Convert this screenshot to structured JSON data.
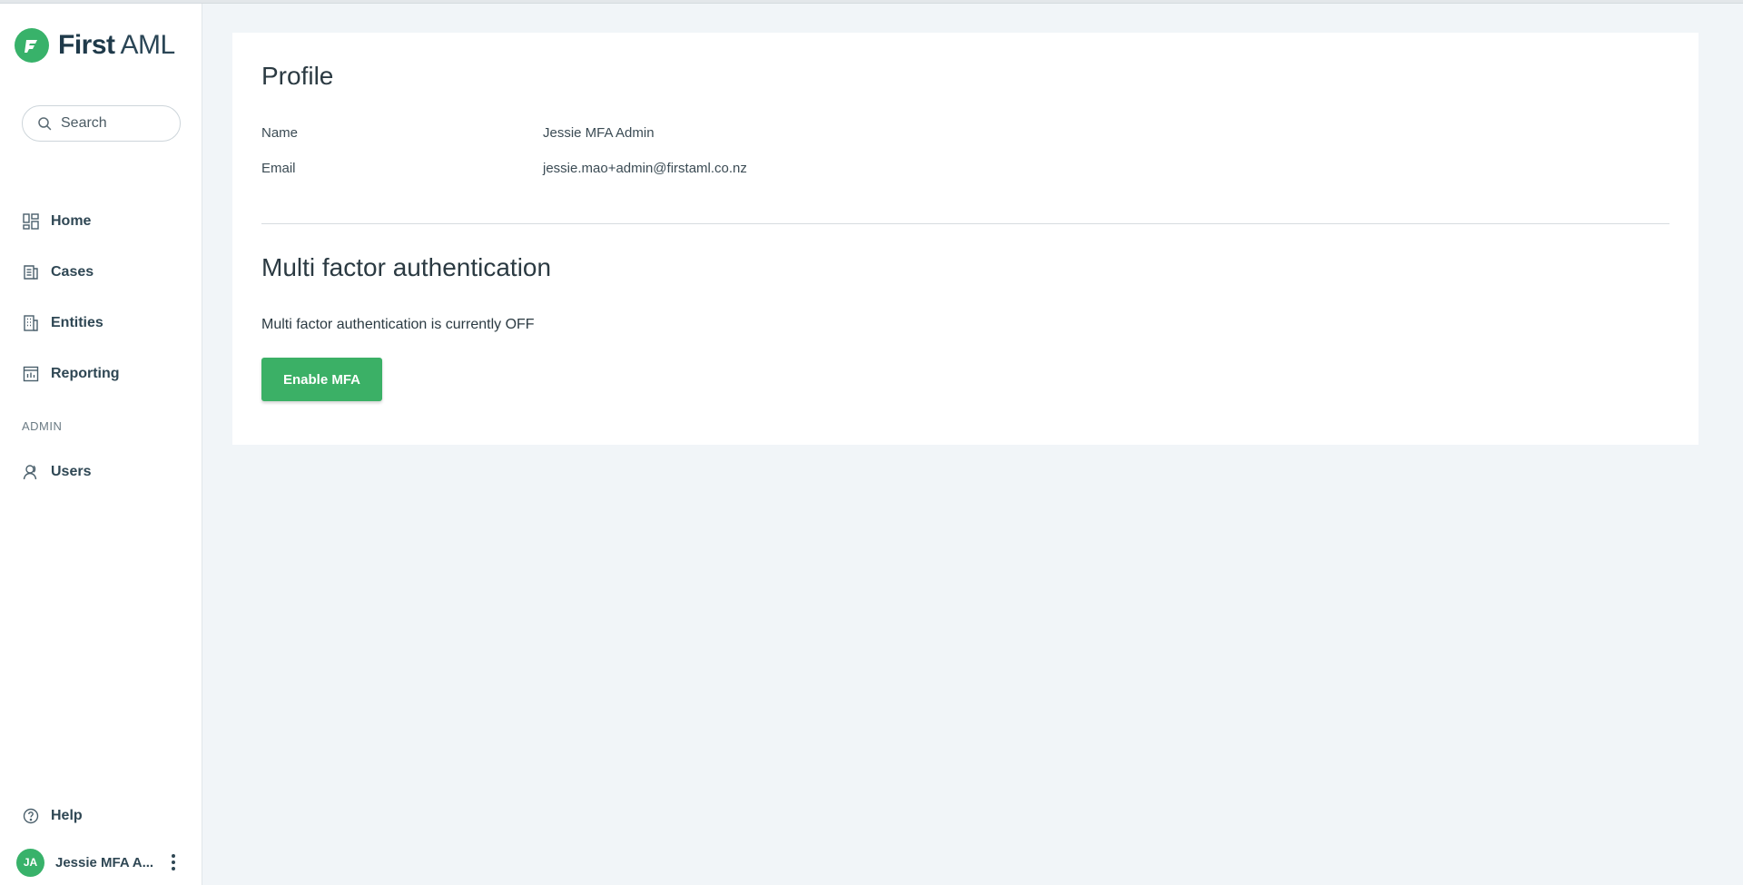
{
  "brand": {
    "name_bold": "First",
    "name_light": "AML",
    "accent_color": "#38b26a"
  },
  "search": {
    "placeholder": "Search"
  },
  "sidebar": {
    "items": [
      {
        "label": "Home",
        "icon": "dashboard-grid-icon"
      },
      {
        "label": "Cases",
        "icon": "document-icon"
      },
      {
        "label": "Entities",
        "icon": "building-icon"
      },
      {
        "label": "Reporting",
        "icon": "chart-icon"
      }
    ],
    "admin_label": "ADMIN",
    "admin_items": [
      {
        "label": "Users",
        "icon": "user-icon"
      }
    ],
    "help_label": "Help",
    "user": {
      "initials": "JA",
      "name": "Jessie MFA A..."
    }
  },
  "profile": {
    "title": "Profile",
    "name_label": "Name",
    "name_value": "Jessie MFA Admin",
    "email_label": "Email",
    "email_value": "jessie.mao+admin@firstaml.co.nz"
  },
  "mfa": {
    "title": "Multi factor authentication",
    "status_text": "Multi factor authentication is currently OFF",
    "button_label": "Enable MFA"
  }
}
